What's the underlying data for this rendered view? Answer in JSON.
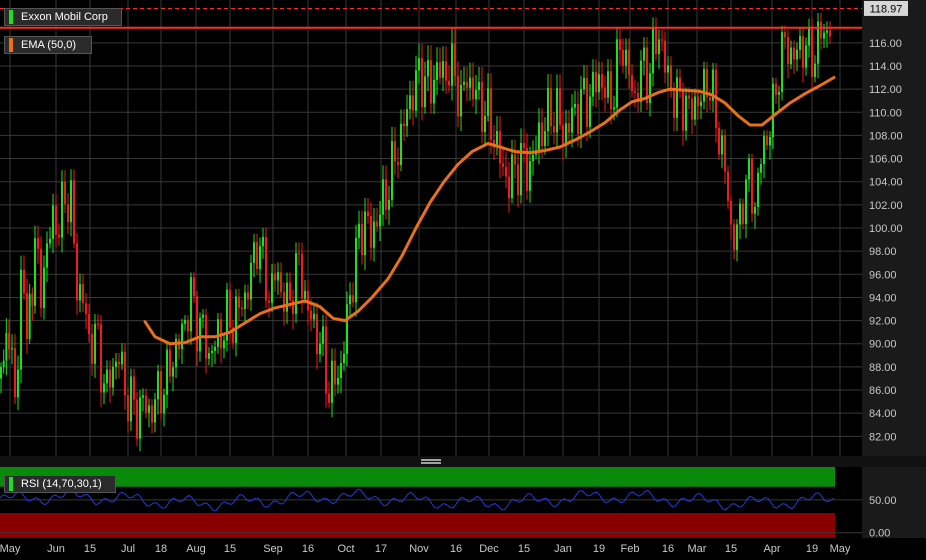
{
  "chart_data": {
    "type": "candlestick",
    "price_panel": {
      "legend_title": "Exxon Mobil Corp",
      "last_price_label": "118.97",
      "last_price": 118.97,
      "resistance_level": 117.3,
      "y_ticks": [
        82,
        84,
        86,
        88,
        90,
        92,
        94,
        96,
        98,
        100,
        102,
        104,
        106,
        108,
        110,
        112,
        114,
        116
      ],
      "y_tick_labels": [
        "82.00",
        "84.00",
        "86.00",
        "88.00",
        "90.00",
        "92.00",
        "94.00",
        "96.00",
        "98.00",
        "100.00",
        "102.00",
        "104.00",
        "106.00",
        "108.00",
        "110.00",
        "112.00",
        "114.00",
        "116.00"
      ],
      "ylim": [
        80.3,
        119.7
      ],
      "close_path": [
        [
          0,
          87
        ],
        [
          8,
          92
        ],
        [
          14,
          84
        ],
        [
          20,
          96
        ],
        [
          26,
          91
        ],
        [
          34,
          98
        ],
        [
          40,
          95
        ],
        [
          46,
          98
        ],
        [
          52,
          101
        ],
        [
          58,
          100
        ],
        [
          64,
          103
        ],
        [
          70,
          102
        ],
        [
          76,
          95
        ],
        [
          82,
          94
        ],
        [
          88,
          90
        ],
        [
          94,
          91
        ],
        [
          100,
          88
        ],
        [
          106,
          86
        ],
        [
          112,
          88
        ],
        [
          118,
          89
        ],
        [
          124,
          86
        ],
        [
          130,
          85
        ],
        [
          136,
          84
        ],
        [
          142,
          85
        ],
        [
          148,
          84
        ],
        [
          154,
          85
        ],
        [
          160,
          86
        ],
        [
          166,
          87
        ],
        [
          172,
          89
        ],
        [
          178,
          90
        ],
        [
          184,
          92
        ],
        [
          190,
          94
        ],
        [
          196,
          92
        ],
        [
          202,
          91
        ],
        [
          208,
          89
        ],
        [
          214,
          90
        ],
        [
          220,
          91
        ],
        [
          226,
          92
        ],
        [
          232,
          92
        ],
        [
          238,
          93
        ],
        [
          244,
          94
        ],
        [
          250,
          96
        ],
        [
          256,
          99
        ],
        [
          262,
          97
        ],
        [
          268,
          94
        ],
        [
          274,
          96
        ],
        [
          280,
          95
        ],
        [
          286,
          93
        ],
        [
          292,
          95
        ],
        [
          298,
          97
        ],
        [
          304,
          94
        ],
        [
          310,
          92
        ],
        [
          316,
          91
        ],
        [
          322,
          89
        ],
        [
          328,
          86
        ],
        [
          334,
          87
        ],
        [
          340,
          88
        ],
        [
          346,
          92
        ],
        [
          352,
          96
        ],
        [
          358,
          99
        ],
        [
          364,
          101
        ],
        [
          370,
          99
        ],
        [
          376,
          101
        ],
        [
          382,
          102
        ],
        [
          388,
          104
        ],
        [
          394,
          106
        ],
        [
          400,
          108
        ],
        [
          406,
          110
        ],
        [
          412,
          112
        ],
        [
          418,
          113
        ],
        [
          424,
          113
        ],
        [
          430,
          112
        ],
        [
          436,
          114
        ],
        [
          442,
          113
        ],
        [
          448,
          114
        ],
        [
          454,
          113
        ],
        [
          460,
          111
        ],
        [
          466,
          113
        ],
        [
          472,
          112
        ],
        [
          478,
          111
        ],
        [
          484,
          110
        ],
        [
          490,
          109
        ],
        [
          496,
          107
        ],
        [
          502,
          105
        ],
        [
          508,
          104
        ],
        [
          514,
          105
        ],
        [
          520,
          106
        ],
        [
          526,
          105
        ],
        [
          532,
          106
        ],
        [
          538,
          108
        ],
        [
          544,
          109
        ],
        [
          550,
          110
        ],
        [
          556,
          110
        ],
        [
          562,
          108
        ],
        [
          568,
          109
        ],
        [
          574,
          110
        ],
        [
          580,
          111
        ],
        [
          586,
          111
        ],
        [
          592,
          112
        ],
        [
          598,
          113
        ],
        [
          604,
          112
        ],
        [
          610,
          111
        ],
        [
          616,
          114
        ],
        [
          622,
          116
        ],
        [
          628,
          113
        ],
        [
          634,
          111
        ],
        [
          640,
          114
        ],
        [
          646,
          113
        ],
        [
          652,
          115
        ],
        [
          658,
          117
        ],
        [
          664,
          114
        ],
        [
          670,
          112
        ],
        [
          676,
          111
        ],
        [
          682,
          111
        ],
        [
          688,
          110
        ],
        [
          694,
          111
        ],
        [
          700,
          111
        ],
        [
          706,
          113
        ],
        [
          712,
          111
        ],
        [
          718,
          108
        ],
        [
          724,
          105
        ],
        [
          730,
          100
        ],
        [
          736,
          99
        ],
        [
          742,
          103
        ],
        [
          748,
          104
        ],
        [
          754,
          102
        ],
        [
          760,
          106
        ],
        [
          766,
          108
        ],
        [
          772,
          110
        ],
        [
          778,
          114
        ],
        [
          784,
          116
        ],
        [
          790,
          115
        ],
        [
          796,
          115
        ],
        [
          802,
          116
        ],
        [
          808,
          115
        ],
        [
          814,
          115
        ],
        [
          820,
          117
        ],
        [
          826,
          117
        ],
        [
          832,
          118
        ]
      ],
      "ema_label": "EMA (50,0)",
      "ema_path": [
        [
          145,
          91.9
        ],
        [
          155,
          90.6
        ],
        [
          170,
          90.0
        ],
        [
          185,
          90.1
        ],
        [
          200,
          90.6
        ],
        [
          215,
          90.6
        ],
        [
          230,
          91.0
        ],
        [
          245,
          91.8
        ],
        [
          260,
          92.6
        ],
        [
          275,
          93.1
        ],
        [
          290,
          93.4
        ],
        [
          305,
          93.7
        ],
        [
          320,
          93.2
        ],
        [
          333,
          92.2
        ],
        [
          345,
          92.0
        ],
        [
          358,
          92.8
        ],
        [
          372,
          94.0
        ],
        [
          388,
          95.6
        ],
        [
          402,
          97.6
        ],
        [
          416,
          100.0
        ],
        [
          430,
          102.2
        ],
        [
          444,
          104.0
        ],
        [
          458,
          105.5
        ],
        [
          472,
          106.6
        ],
        [
          488,
          107.3
        ],
        [
          500,
          107.0
        ],
        [
          515,
          106.6
        ],
        [
          530,
          106.5
        ],
        [
          545,
          106.7
        ],
        [
          560,
          107.0
        ],
        [
          575,
          107.6
        ],
        [
          590,
          108.3
        ],
        [
          605,
          109.1
        ],
        [
          620,
          110.2
        ],
        [
          632,
          110.9
        ],
        [
          645,
          111.2
        ],
        [
          658,
          111.7
        ],
        [
          670,
          112.0
        ],
        [
          685,
          111.9
        ],
        [
          700,
          111.8
        ],
        [
          712,
          111.5
        ],
        [
          725,
          110.8
        ],
        [
          738,
          109.7
        ],
        [
          750,
          108.9
        ],
        [
          762,
          108.9
        ],
        [
          775,
          109.8
        ],
        [
          790,
          110.8
        ],
        [
          805,
          111.6
        ],
        [
          820,
          112.3
        ],
        [
          834,
          113.0
        ]
      ]
    },
    "rsi_panel": {
      "label": "RSI (14,70,30,1)",
      "y_ticks": [
        0,
        50
      ],
      "y_tick_labels": [
        "0.00",
        "50.00"
      ],
      "ylim": [
        -8,
        100
      ],
      "overbought": 70,
      "oversold": 30
    },
    "x_ticks": [
      {
        "label": "May",
        "x": 10
      },
      {
        "label": "Jun",
        "x": 56
      },
      {
        "label": "15",
        "x": 90
      },
      {
        "label": "Jul",
        "x": 128
      },
      {
        "label": "18",
        "x": 161
      },
      {
        "label": "Aug",
        "x": 196
      },
      {
        "label": "15",
        "x": 230
      },
      {
        "label": "Sep",
        "x": 273
      },
      {
        "label": "16",
        "x": 308
      },
      {
        "label": "Oct",
        "x": 346
      },
      {
        "label": "17",
        "x": 381
      },
      {
        "label": "Nov",
        "x": 419
      },
      {
        "label": "16",
        "x": 456
      },
      {
        "label": "Dec",
        "x": 489
      },
      {
        "label": "15",
        "x": 524
      },
      {
        "label": "Jan",
        "x": 563
      },
      {
        "label": "19",
        "x": 599
      },
      {
        "label": "Feb",
        "x": 630
      },
      {
        "label": "16",
        "x": 668
      },
      {
        "label": "Mar",
        "x": 697
      },
      {
        "label": "15",
        "x": 731
      },
      {
        "label": "Apr",
        "x": 772
      },
      {
        "label": "19",
        "x": 812
      },
      {
        "label": "May",
        "x": 840
      }
    ],
    "colors": {
      "up": "#1fe01f",
      "down": "#ee1c1c",
      "ema": "#e8701a",
      "resistance": "#ff2a2a",
      "rsi_line": "#2438e0",
      "overbought_zone": "#0a8a0a",
      "oversold_zone": "#8a0000",
      "grid": "#383838",
      "background": "#000000",
      "axis_bg": "#1a1a1a"
    }
  }
}
